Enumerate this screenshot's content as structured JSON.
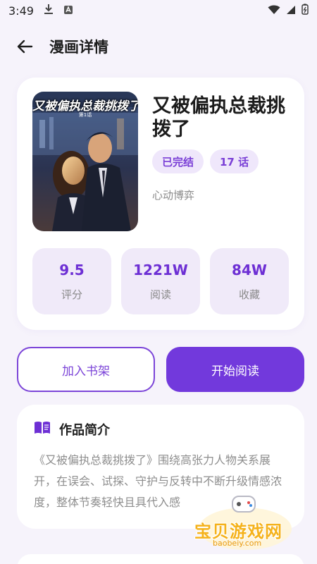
{
  "status_bar": {
    "time": "3:49"
  },
  "header": {
    "title": "漫画详情"
  },
  "comic": {
    "cover_text": "又被偏执总裁挑拨了",
    "cover_sub": "第1话",
    "title": "又被偏执总裁挑拨了",
    "status_tag": "已完结",
    "episodes_tag": "17 话",
    "author": "心动博弈",
    "stats": [
      {
        "value": "9.5",
        "label": "评分"
      },
      {
        "value": "1221W",
        "label": "阅读"
      },
      {
        "value": "84W",
        "label": "收藏"
      }
    ]
  },
  "actions": {
    "shelf_label": "加入书架",
    "read_label": "开始阅读"
  },
  "intro": {
    "title": "作品简介",
    "text": "《又被偏执总裁挑拨了》围绕高张力人物关系展开，在误会、试探、守护与反转中不断升级情感浓度，整体节奏轻快且具代入感"
  },
  "watermark": {
    "main": "宝贝游戏网",
    "url": "baobeiy.com"
  },
  "colors": {
    "accent": "#7239dc",
    "tag_bg": "#efe7fb",
    "background": "#f6f3fb"
  }
}
